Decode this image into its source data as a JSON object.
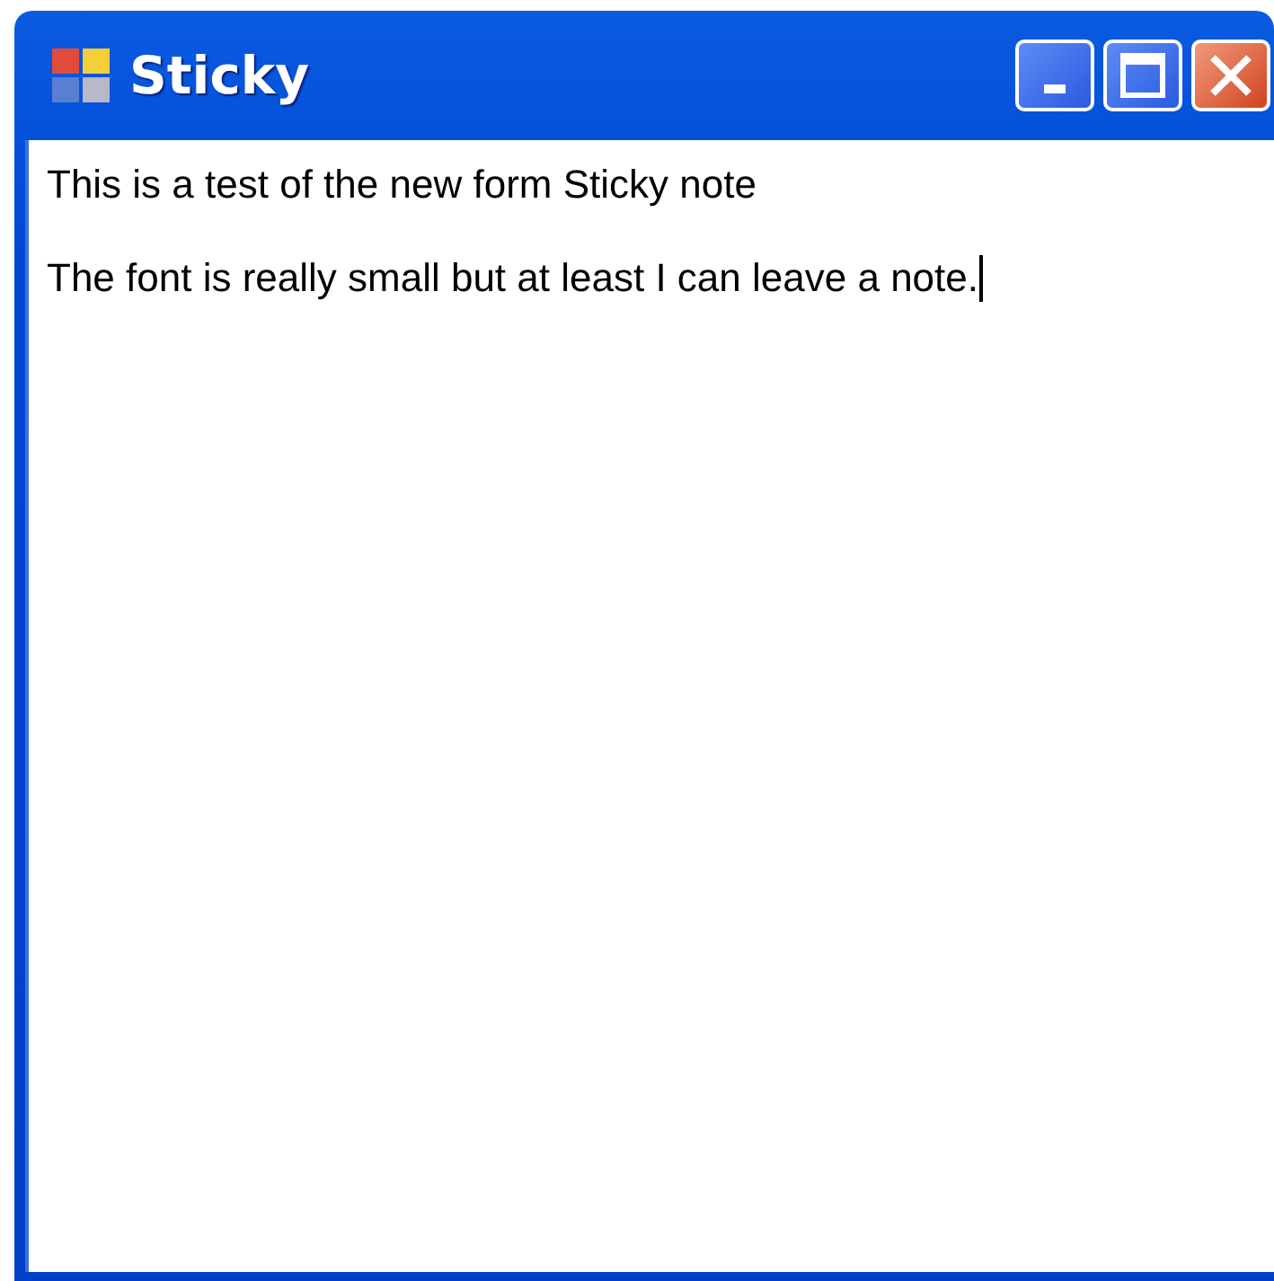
{
  "window": {
    "title": "Sticky"
  },
  "note": {
    "lines": [
      "This is a test of the new form Sticky note",
      "The font is really small but at least I can leave a note."
    ],
    "caret_visible": true
  }
}
